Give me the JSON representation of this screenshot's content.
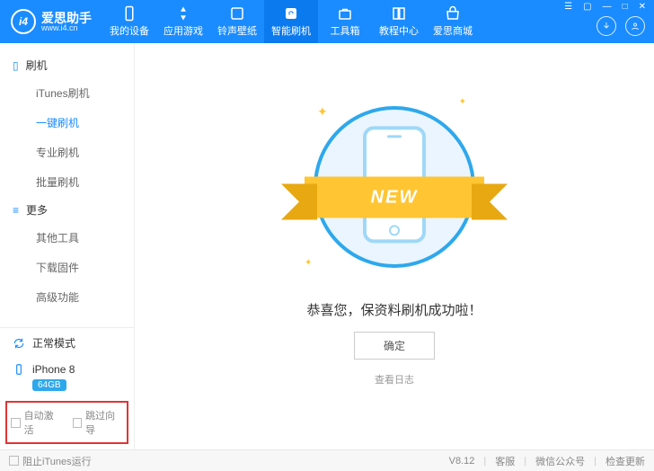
{
  "app": {
    "name": "爱思助手",
    "url": "www.i4.cn",
    "logo_text": "i4"
  },
  "nav": [
    {
      "key": "device",
      "label": "我的设备"
    },
    {
      "key": "games",
      "label": "应用游戏"
    },
    {
      "key": "ring",
      "label": "铃声壁纸"
    },
    {
      "key": "flash",
      "label": "智能刷机",
      "active": true
    },
    {
      "key": "toolbox",
      "label": "工具箱"
    },
    {
      "key": "tutorial",
      "label": "教程中心"
    },
    {
      "key": "mall",
      "label": "爱思商城"
    }
  ],
  "sidebar": {
    "groups": [
      {
        "title": "刷机",
        "icon": "phone",
        "items": [
          {
            "label": "iTunes刷机"
          },
          {
            "label": "一键刷机",
            "active": true
          },
          {
            "label": "专业刷机"
          },
          {
            "label": "批量刷机"
          }
        ]
      },
      {
        "title": "更多",
        "icon": "more",
        "items": [
          {
            "label": "其他工具"
          },
          {
            "label": "下载固件"
          },
          {
            "label": "高级功能"
          }
        ]
      }
    ],
    "mode_label": "正常模式",
    "device": {
      "name": "iPhone 8",
      "storage": "64GB"
    },
    "auto_activate": "自动激活",
    "skip_guide": "跳过向导"
  },
  "main": {
    "ribbon": "NEW",
    "message": "恭喜您，保资料刷机成功啦！",
    "ok": "确定",
    "view_log": "查看日志"
  },
  "footer": {
    "block_itunes": "阻止iTunes运行",
    "version": "V8.12",
    "support": "客服",
    "wechat": "微信公众号",
    "update": "检查更新"
  }
}
